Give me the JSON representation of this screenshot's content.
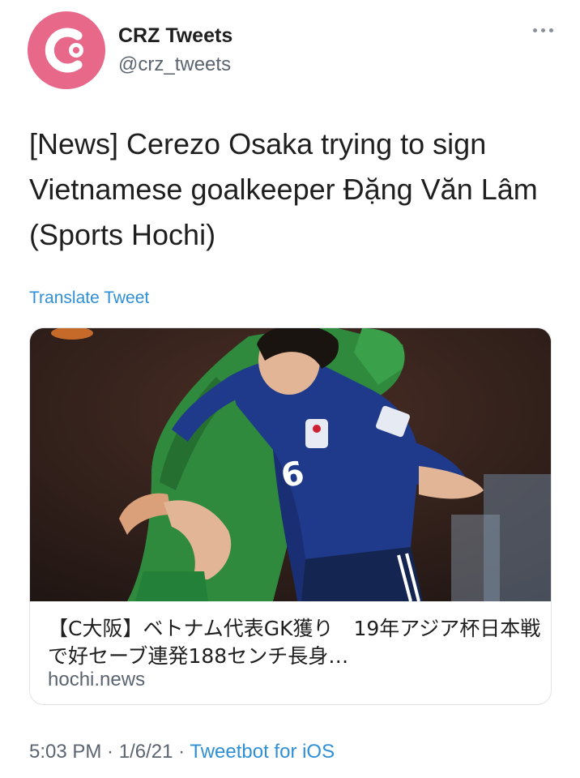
{
  "account": {
    "display_name": "CRZ Tweets",
    "handle": "@crz_tweets",
    "avatar_icon": "cerezo-logo-icon",
    "avatar_color": "#e8688a"
  },
  "more_icon": "more-dots-icon",
  "tweet": {
    "text": "[News] Cerezo Osaka trying to sign Vietnamese goalkeeper Đặng Văn Lâm (Sports Hochi)",
    "translate_label": "Translate Tweet"
  },
  "card": {
    "title": "【C大阪】ベトナム代表GK獲り　19年アジア杯日本戦で好セーブ連発188センチ長身…",
    "domain": "hochi.news"
  },
  "meta": {
    "time": "5:03 PM",
    "separator": " · ",
    "date": "1/6/21",
    "source": "Tweetbot for iOS"
  },
  "colors": {
    "link": "#2f8fd6",
    "secondary_text": "#5b6470",
    "jersey_blue": "#1f3a8a",
    "goalkeeper_green": "#2f8a3e"
  }
}
